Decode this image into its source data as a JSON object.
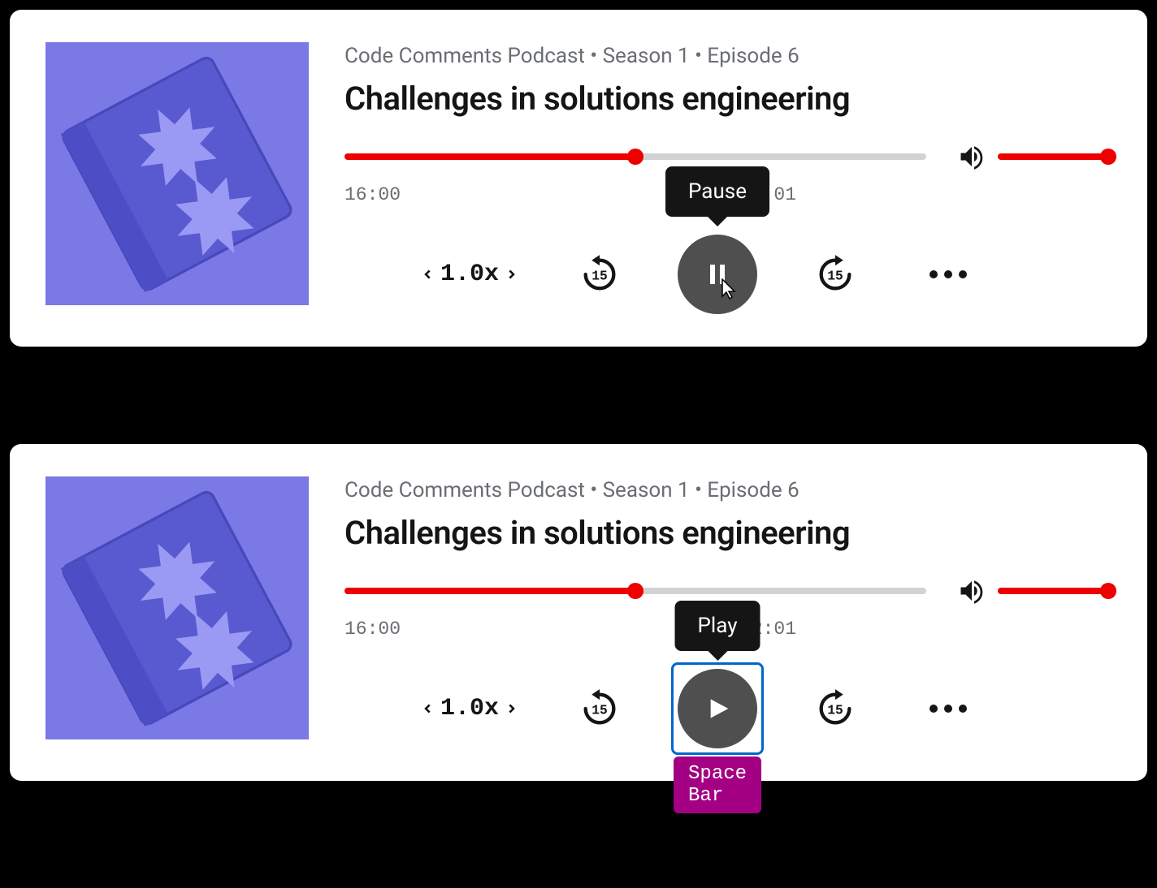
{
  "players": [
    {
      "meta": "Code Comments Podcast • Season 1 • Episode 6",
      "title": "Challenges in solutions engineering",
      "elapsed": "16:00",
      "total": "32:01",
      "progress_pct": 50,
      "volume_pct": 100,
      "speed": "1.0x",
      "skip_seconds": "15",
      "tooltip": "Pause",
      "state": "playing",
      "focused": false,
      "show_cursor": true
    },
    {
      "meta": "Code Comments Podcast • Season 1 • Episode 6",
      "title": "Challenges in solutions engineering",
      "elapsed": "16:00",
      "total": "32:01",
      "progress_pct": 50,
      "volume_pct": 100,
      "speed": "1.0x",
      "skip_seconds": "15",
      "tooltip": "Play",
      "state": "paused",
      "focused": true,
      "show_cursor": false,
      "keycap": "Space Bar"
    }
  ],
  "colors": {
    "accent": "#ee0000",
    "focus": "#0066cc",
    "keycap": "#a30083"
  }
}
